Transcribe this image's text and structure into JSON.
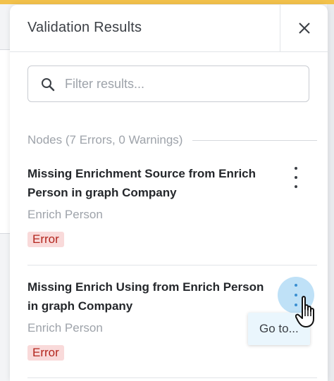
{
  "panel": {
    "title": "Validation Results"
  },
  "search": {
    "placeholder": "Filter results..."
  },
  "section": {
    "label": "Nodes (7 Errors, 0 Warnings)"
  },
  "results": [
    {
      "title": "Missing Enrichment Source from Enrich Person in graph Company",
      "node": "Enrich Person",
      "severity": "Error"
    },
    {
      "title": "Missing Enrich Using from Enrich Person in graph Company",
      "node": "Enrich Person",
      "severity": "Error"
    }
  ],
  "context_menu": {
    "goto_label": "Go to..."
  },
  "icons": {
    "close": "close-icon",
    "search": "search-icon",
    "kebab": "kebab-menu-icon",
    "cursor": "hand-pointer-cursor-icon"
  },
  "colors": {
    "error_badge_bg": "#f9dada",
    "error_badge_text": "#b3261e",
    "active_button_bg": "#bfe1f7",
    "accent": "#3a8fd1",
    "menu_bg": "#eaf6fd"
  }
}
